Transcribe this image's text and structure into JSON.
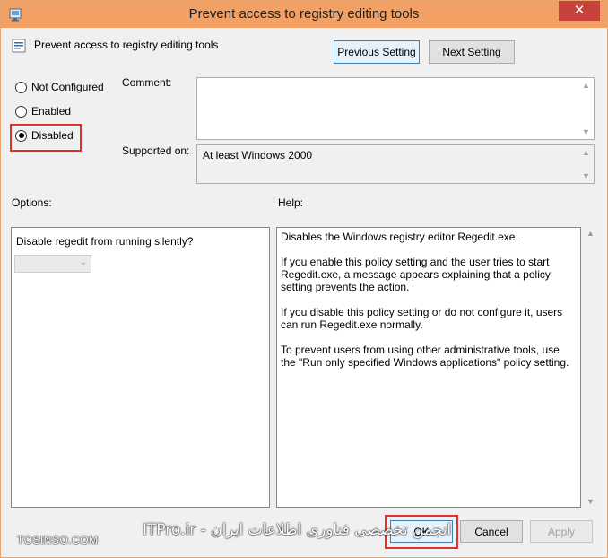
{
  "window": {
    "title": "Prevent access to registry editing tools",
    "close_label": "✕"
  },
  "header": {
    "policy_name": "Prevent access to registry editing tools",
    "previous_label": "Previous Setting",
    "next_label": "Next Setting"
  },
  "state": {
    "options": [
      {
        "label": "Not Configured",
        "checked": false
      },
      {
        "label": "Enabled",
        "checked": false
      },
      {
        "label": "Disabled",
        "checked": true
      }
    ]
  },
  "comment": {
    "label": "Comment:",
    "value": ""
  },
  "supported": {
    "label": "Supported on:",
    "value": "At least Windows 2000"
  },
  "options_panel": {
    "label": "Options:",
    "prompt": "Disable regedit from running silently?",
    "dropdown_value": ""
  },
  "help_panel": {
    "label": "Help:",
    "paragraphs": [
      "Disables the Windows registry editor Regedit.exe.",
      "If you enable this policy setting and the user tries to start Regedit.exe, a message appears explaining that a policy setting prevents the action.",
      "If you disable this policy setting or do not configure it, users can run Regedit.exe normally.",
      "To prevent users from using other administrative tools, use the \"Run only specified Windows applications\" policy setting."
    ]
  },
  "footer": {
    "ok_label": "OK",
    "cancel_label": "Cancel",
    "apply_label": "Apply"
  },
  "watermark": {
    "left": "TOSINSO.COM",
    "center": "انجمن تخصصی فناوری اطلاعات ایران - ITPro.ir"
  },
  "colors": {
    "titlebar": "#f2a064",
    "close": "#c7423a",
    "highlight": "#e0312f"
  }
}
